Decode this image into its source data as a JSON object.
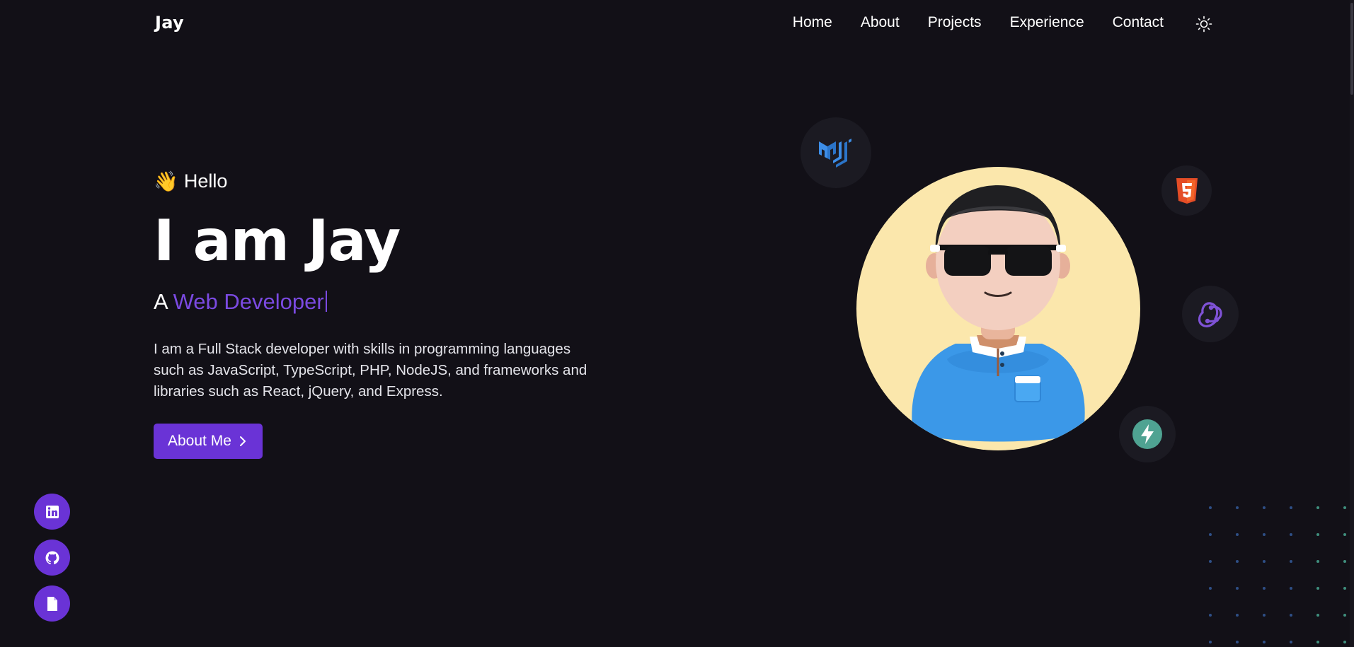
{
  "nav": {
    "logo": "Jay",
    "links": [
      "Home",
      "About",
      "Projects",
      "Experience",
      "Contact"
    ],
    "theme_icon": "sun-icon"
  },
  "hero": {
    "greeting": "Hello",
    "wave_emoji": "👋",
    "headline": "I am Jay",
    "role_prefix": "A",
    "role_accent": "Web Developer",
    "bio": "I am a Full Stack developer with skills in programming languages such as JavaScript, TypeScript, PHP, NodeJS, and frameworks and libraries such as React, jQuery, and Express.",
    "cta_label": "About Me",
    "cta_icon": "chevron-right-icon"
  },
  "tech_icons": [
    "mui-icon",
    "html5-icon",
    "redux-icon",
    "fastapi-icon"
  ],
  "social": [
    "linkedin-icon",
    "github-icon",
    "document-icon"
  ],
  "colors": {
    "background": "#121017",
    "accent": "#6a33d6",
    "accent_text": "#7b4ae2",
    "avatar_bg": "#fbe7ac",
    "bubble_bg": "#1b1a22"
  }
}
